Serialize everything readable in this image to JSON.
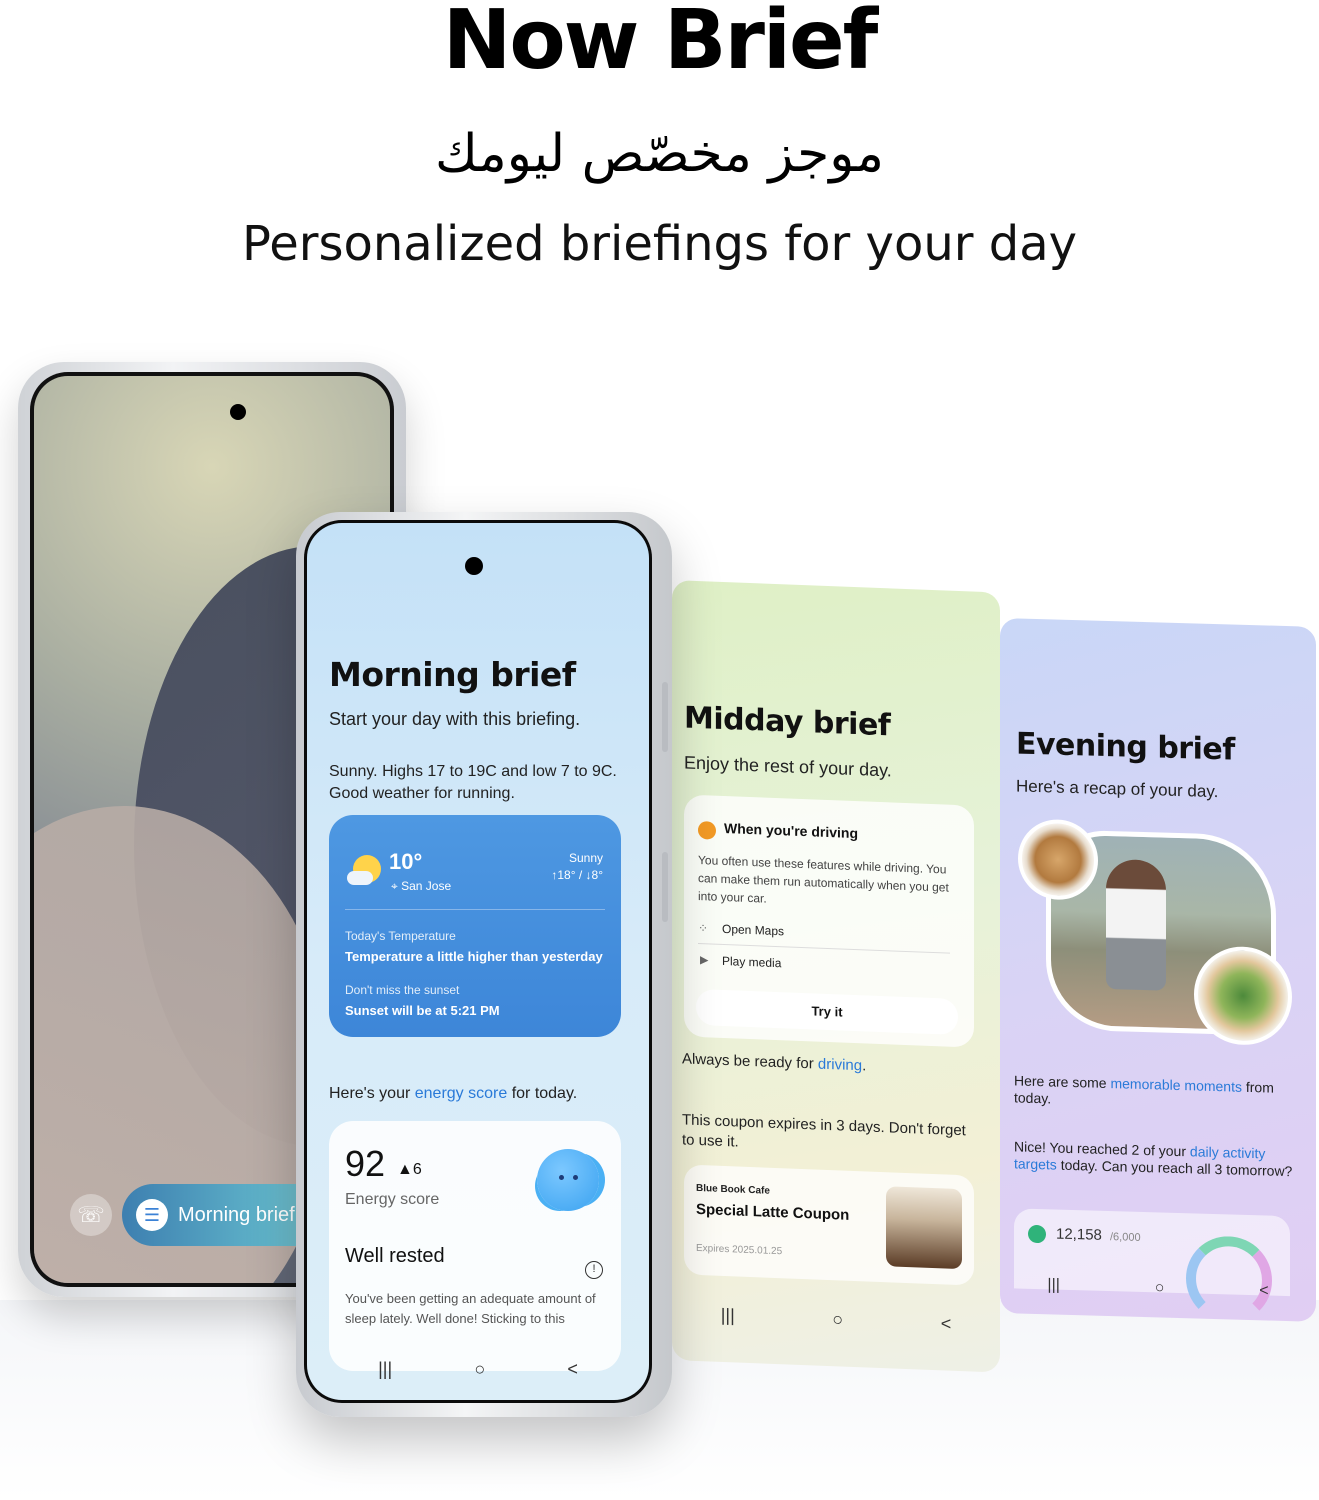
{
  "hero": {
    "title": "Now Brief",
    "arabic": "موجز مخصّص ليومك",
    "subtitle": "Personalized briefings for your day"
  },
  "back_phone": {
    "pill_label": "Morning brief"
  },
  "morning": {
    "title": "Morning brief",
    "subtitle": "Start your day with this briefing.",
    "weather_text": "Sunny. Highs 17 to 19C and low 7 to 9C. Good weather for running.",
    "weather_card": {
      "temp": "10°",
      "city": "San Jose",
      "condition": "Sunny",
      "high_low": "↑18° / ↓8°",
      "label1": "Today's Temperature",
      "value1": "Temperature a little higher than yesterday",
      "label2": "Don't miss the sunset",
      "value2": "Sunset will be at 5:21 PM"
    },
    "energy_intro_pre": "Here's your ",
    "energy_intro_link": "energy score",
    "energy_intro_post": " for today.",
    "energy_card": {
      "score": "92",
      "delta": "▲6",
      "label": "Energy score",
      "status": "Well rested",
      "info": "!",
      "desc": "You've been getting an adequate amount of sleep lately. Well done! Sticking to this"
    }
  },
  "midday": {
    "title": "Midday brief",
    "subtitle": "Enjoy the rest of your day.",
    "driving": {
      "title": "When you're driving",
      "desc": "You often use these features while driving. You can make them run automatically when you get into your car.",
      "option1": "Open Maps",
      "option2": "Play media",
      "button": "Try it"
    },
    "ready_pre": "Always be ready for ",
    "ready_link": "driving",
    "ready_post": ".",
    "coupon_text": "This coupon expires in 3 days. Don't forget to use it.",
    "coupon": {
      "shop": "Blue Book Cafe",
      "name": "Special Latte Coupon",
      "expires": "Expires 2025.01.25"
    }
  },
  "evening": {
    "title": "Evening brief",
    "subtitle": "Here's a recap of your day.",
    "moments_pre": "Here are some ",
    "moments_link": "memorable moments",
    "moments_post": " from today.",
    "activity_pre": "Nice! You reached 2 of your ",
    "activity_link": "daily activity targets",
    "activity_post": " today. Can you reach all 3 tomorrow?",
    "steps": "12,158",
    "steps_goal": "/6,000"
  },
  "nav": {
    "recents": "|||",
    "home": "○",
    "back": "<"
  },
  "icons": {
    "phone": "phone-icon",
    "brief": "brief-icon",
    "location": "location-pin-icon",
    "maps": "maps-icon",
    "play": "play-icon"
  }
}
